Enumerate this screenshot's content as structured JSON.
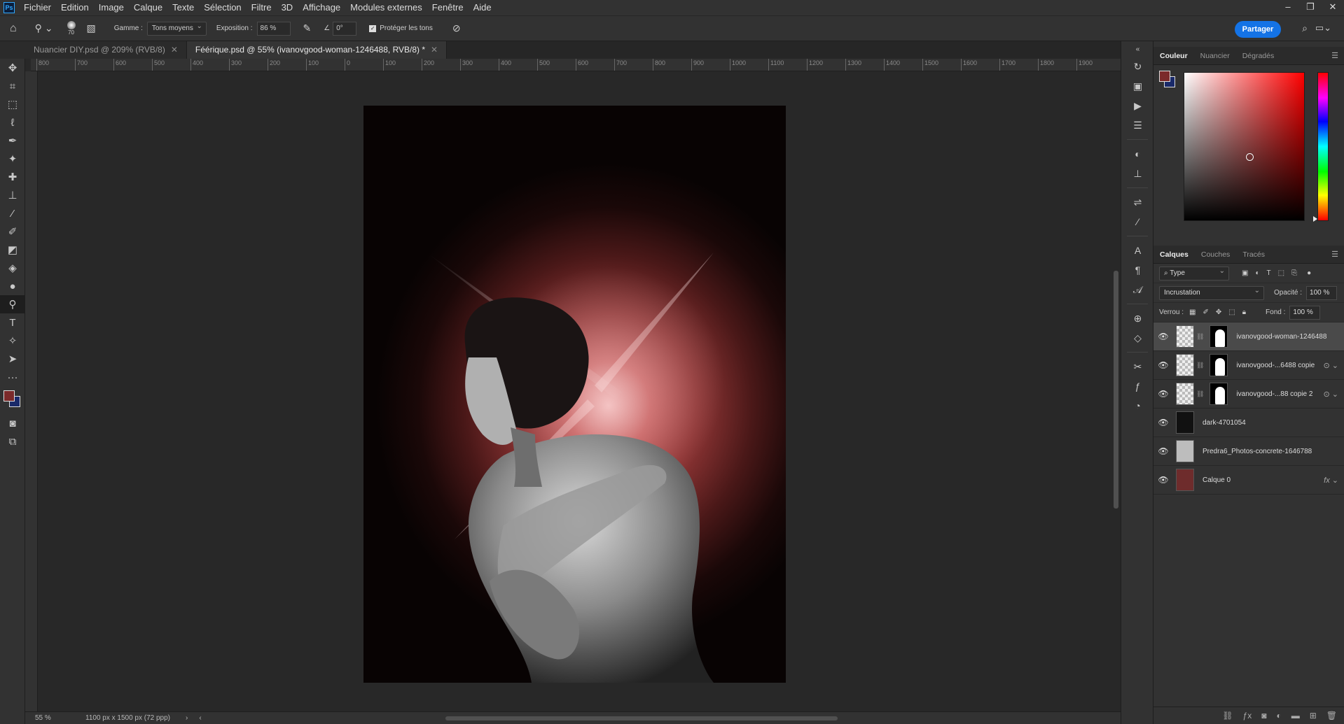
{
  "app": {
    "logo": "Ps"
  },
  "menu": [
    "Fichier",
    "Edition",
    "Image",
    "Calque",
    "Texte",
    "Sélection",
    "Filtre",
    "3D",
    "Affichage",
    "Modules externes",
    "Fenêtre",
    "Aide"
  ],
  "window_controls": {
    "minimize": "–",
    "restore": "❐",
    "close": "✕"
  },
  "options": {
    "brush_size": "70",
    "range_label": "Gamme :",
    "range_value": "Tons moyens",
    "exposure_label": "Exposition :",
    "exposure_value": "86 %",
    "angle_value": "0°",
    "protect_tones_label": "Protéger les tons",
    "share_label": "Partager"
  },
  "tabs": [
    {
      "label": "Nuancier DIY.psd @ 209% (RVB/8)"
    },
    {
      "label": "Féérique.psd @ 55% (ivanovgood-woman-1246488, RVB/8) *"
    }
  ],
  "ruler_ticks": [
    "800",
    "700",
    "600",
    "500",
    "400",
    "300",
    "200",
    "100",
    "0",
    "100",
    "200",
    "300",
    "400",
    "500",
    "600",
    "700",
    "800",
    "900",
    "1000",
    "1100",
    "1200",
    "1300",
    "1400",
    "1500",
    "1600",
    "1700",
    "1800",
    "1900"
  ],
  "status": {
    "zoom": "55 %",
    "doc_info": "1100 px x 1500 px (72 ppp)"
  },
  "color_panel": {
    "tabs": [
      "Couleur",
      "Nuancier",
      "Dégradés"
    ],
    "foreground": "#7b2a2a",
    "background": "#1a2a6a"
  },
  "layers_panel": {
    "tabs": [
      "Calques",
      "Couches",
      "Tracés"
    ],
    "filter_label": "Type",
    "blend_mode": "Incrustation",
    "opacity_label": "Opacité :",
    "opacity_value": "100 %",
    "lock_label": "Verrou :",
    "fill_label": "Fond :",
    "fill_value": "100 %",
    "layers": [
      {
        "name": "ivanovgood-woman-1246488",
        "selected": true,
        "has_mask": true
      },
      {
        "name": "ivanovgood-...6488 copie",
        "selected": false,
        "has_mask": true
      },
      {
        "name": "ivanovgood-...88 copie 2",
        "selected": false,
        "has_mask": true
      },
      {
        "name": "dark-4701054",
        "selected": false,
        "has_mask": false
      },
      {
        "name": "Predra6_Photos-concrete-1646788",
        "selected": false,
        "has_mask": false
      },
      {
        "name": "Calque 0",
        "selected": false,
        "has_mask": false,
        "fx": "fx"
      }
    ]
  }
}
